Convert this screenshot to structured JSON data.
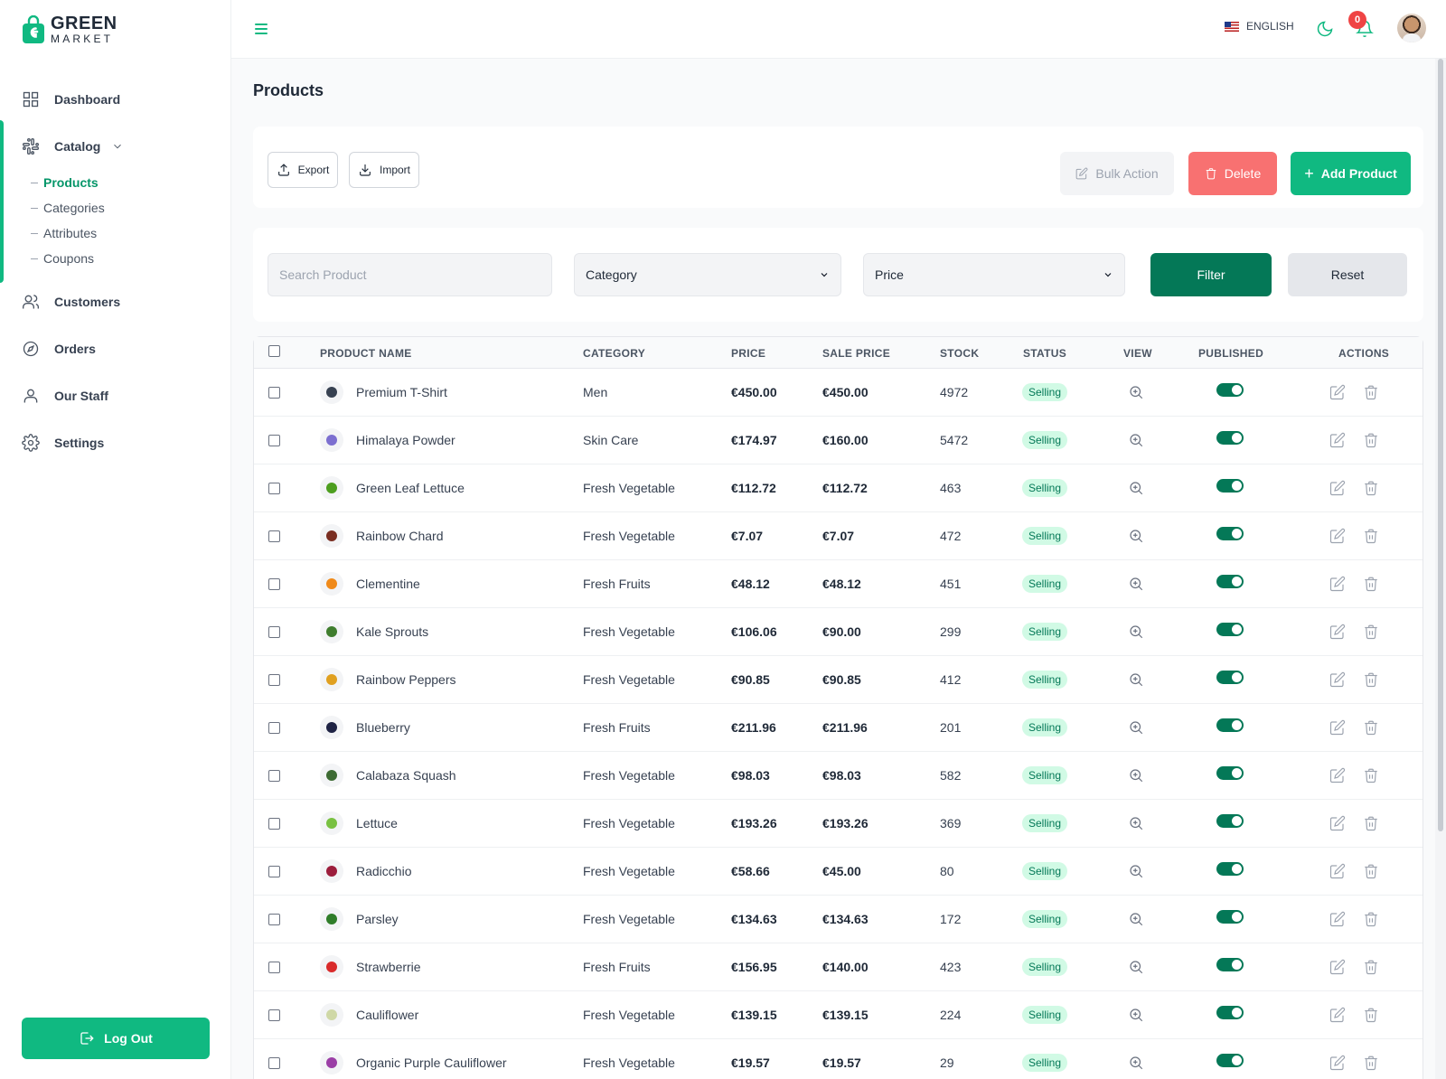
{
  "brand": {
    "line1": "GREEN",
    "line2": "MARKET",
    "color": "#10b981"
  },
  "sidebar": {
    "items": [
      {
        "label": "Dashboard",
        "icon": "grid-icon"
      },
      {
        "label": "Catalog",
        "icon": "slack-icon",
        "expanded": true,
        "children": [
          "Products",
          "Categories",
          "Attributes",
          "Coupons"
        ],
        "active_child": "Products"
      },
      {
        "label": "Customers",
        "icon": "users-icon"
      },
      {
        "label": "Orders",
        "icon": "compass-icon"
      },
      {
        "label": "Our Staff",
        "icon": "user-icon"
      },
      {
        "label": "Settings",
        "icon": "settings-icon"
      }
    ],
    "logout": "Log Out"
  },
  "header": {
    "language": "ENGLISH",
    "notifications": "0"
  },
  "page": {
    "title": "Products"
  },
  "actions": {
    "export": "Export",
    "import": "Import",
    "bulk": "Bulk Action",
    "delete": "Delete",
    "add": "Add Product"
  },
  "filters": {
    "search_placeholder": "Search Product",
    "category": "Category",
    "price": "Price",
    "filter": "Filter",
    "reset": "Reset"
  },
  "table": {
    "headers": [
      "PRODUCT NAME",
      "CATEGORY",
      "PRICE",
      "SALE PRICE",
      "STOCK",
      "STATUS",
      "VIEW",
      "PUBLISHED",
      "ACTIONS"
    ],
    "rows": [
      {
        "name": "Premium T-Shirt",
        "category": "Men",
        "price": "€450.00",
        "sale": "€450.00",
        "stock": "4972",
        "status": "Selling",
        "color": "#374151"
      },
      {
        "name": "Himalaya Powder",
        "category": "Skin Care",
        "price": "€174.97",
        "sale": "€160.00",
        "stock": "5472",
        "status": "Selling",
        "color": "#7c6fd0"
      },
      {
        "name": "Green Leaf Lettuce",
        "category": "Fresh Vegetable",
        "price": "€112.72",
        "sale": "€112.72",
        "stock": "463",
        "status": "Selling",
        "color": "#4d9e1f"
      },
      {
        "name": "Rainbow Chard",
        "category": "Fresh Vegetable",
        "price": "€7.07",
        "sale": "€7.07",
        "stock": "472",
        "status": "Selling",
        "color": "#7a2e22"
      },
      {
        "name": "Clementine",
        "category": "Fresh Fruits",
        "price": "€48.12",
        "sale": "€48.12",
        "stock": "451",
        "status": "Selling",
        "color": "#f08a1a"
      },
      {
        "name": "Kale Sprouts",
        "category": "Fresh Vegetable",
        "price": "€106.06",
        "sale": "€90.00",
        "stock": "299",
        "status": "Selling",
        "color": "#3f7d2e"
      },
      {
        "name": "Rainbow Peppers",
        "category": "Fresh Vegetable",
        "price": "€90.85",
        "sale": "€90.85",
        "stock": "412",
        "status": "Selling",
        "color": "#e0a020"
      },
      {
        "name": "Blueberry",
        "category": "Fresh Fruits",
        "price": "€211.96",
        "sale": "€211.96",
        "stock": "201",
        "status": "Selling",
        "color": "#1f2344"
      },
      {
        "name": "Calabaza Squash",
        "category": "Fresh Vegetable",
        "price": "€98.03",
        "sale": "€98.03",
        "stock": "582",
        "status": "Selling",
        "color": "#3d6b33"
      },
      {
        "name": "Lettuce",
        "category": "Fresh Vegetable",
        "price": "€193.26",
        "sale": "€193.26",
        "stock": "369",
        "status": "Selling",
        "color": "#79c142"
      },
      {
        "name": "Radicchio",
        "category": "Fresh Vegetable",
        "price": "€58.66",
        "sale": "€45.00",
        "stock": "80",
        "status": "Selling",
        "color": "#9c1d3c"
      },
      {
        "name": "Parsley",
        "category": "Fresh Vegetable",
        "price": "€134.63",
        "sale": "€134.63",
        "stock": "172",
        "status": "Selling",
        "color": "#2f7d2a"
      },
      {
        "name": "Strawberrie",
        "category": "Fresh Fruits",
        "price": "€156.95",
        "sale": "€140.00",
        "stock": "423",
        "status": "Selling",
        "color": "#d92b2b"
      },
      {
        "name": "Cauliflower",
        "category": "Fresh Vegetable",
        "price": "€139.15",
        "sale": "€139.15",
        "stock": "224",
        "status": "Selling",
        "color": "#cfd8a6"
      },
      {
        "name": "Organic Purple Cauliflower",
        "category": "Fresh Vegetable",
        "price": "€19.57",
        "sale": "€19.57",
        "stock": "29",
        "status": "Selling",
        "color": "#9b3fa6"
      }
    ]
  }
}
